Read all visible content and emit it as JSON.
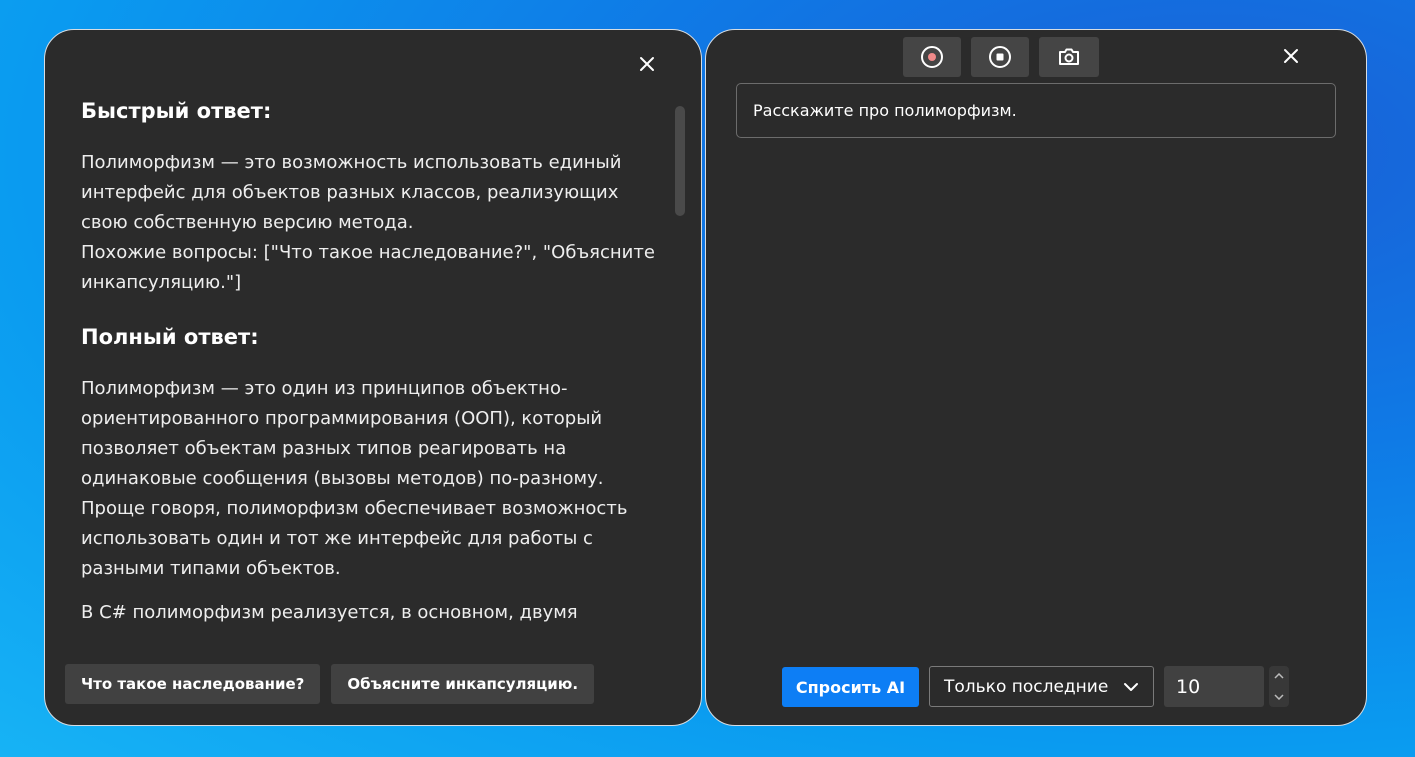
{
  "left_panel": {
    "quick_answer": {
      "heading": "Быстрый ответ:",
      "text": "Полиморфизм — это возможность использовать единый интерфейс для объектов разных классов, реализующих свою собственную версию метода.",
      "related": "Похожие вопросы: [\"Что такое наследование?\", \"Объясните инкапсуляцию.\"]"
    },
    "full_answer": {
      "heading": "Полный ответ:",
      "paragraph_1": "Полиморфизм — это один из принципов объектно-ориентированного программирования (ООП), который позволяет объектам разных типов реагировать на одинаковые сообщения (вызовы методов) по-разному. Проще говоря, полиморфизм обеспечивает возможность использовать один и тот же интерфейс для работы с разными типами объектов.",
      "paragraph_2": "В C# полиморфизм реализуется, в основном, двумя"
    },
    "suggestions": [
      "Что такое наследование?",
      "Объясните инкапсуляцию."
    ]
  },
  "right_panel": {
    "toolbar": [
      "record-icon",
      "stop-icon",
      "camera-icon"
    ],
    "question": "Расскажите про полиморфизм.",
    "ask_button": "Спросить AI",
    "mode_select": "Только последние",
    "count": "10"
  },
  "colors": {
    "panel_bg": "#2b2b2b",
    "accent": "#0d7ef5",
    "record_dot": "#f08a8a"
  }
}
